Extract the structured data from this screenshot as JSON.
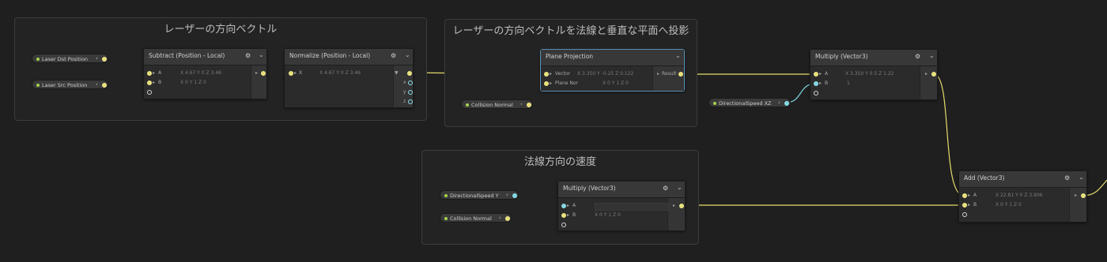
{
  "groups": {
    "laser_dir": "レーザーの方向ベクトル",
    "projection": "レーザーの方向ベクトルを法線と垂直な平面へ投影",
    "normal_speed": "法線方向の速度"
  },
  "props": {
    "laser_dst": "Laser Dst Position",
    "laser_src": "Laser Src Position",
    "collision_normal_1": "Collision Normal",
    "directional_speed_xz": "DirectionalSpeed XZ",
    "directional_speed_y": "DirectionalSpeed Y",
    "collision_normal_2": "Collision Normal"
  },
  "nodes": {
    "subtract": {
      "title": "Subtract (Position - Local)",
      "in_a": "A",
      "in_b": "B",
      "a_fields": "X 4.67  Y 0      Z 3.46",
      "b_fields": "X 0      Y 1      Z 0"
    },
    "normalize": {
      "title": "Normalize (Position - Local)",
      "in_x": "X",
      "x_fields": "X 4.67  Y 0      Z 3.46",
      "out_x": "x",
      "out_y": "y",
      "out_z": "z"
    },
    "plane_proj": {
      "title": "Plane Projection",
      "in_vector": "Vector",
      "in_plane": "Plane Nor",
      "vector_fields": "X 3.350   Y -0.25   Z 0.122",
      "plane_fields": "X 0   Y 1   Z 0",
      "out_result": "Result"
    },
    "multiply_top": {
      "title": "Multiply (Vector3)",
      "in_a": "A",
      "in_b": "B",
      "a_fields": "X 3.350   Y 0.5    Z 1.22",
      "b_fields": "1"
    },
    "multiply_bottom": {
      "title": "Multiply (Vector3)",
      "in_a": "A",
      "in_b": "B",
      "b_fields": "X 0      Y 1      Z 0"
    },
    "add": {
      "title": "Add (Vector3)",
      "in_a": "A",
      "in_b": "B",
      "a_fields": "X 22.81   Y 0      Z 3.906",
      "b_fields": "X 0      Y 1      Z 0"
    }
  },
  "icons": {
    "gear": "gear-icon",
    "chevron": "chevron-down-icon",
    "collapse": "collapse-arrow-icon"
  },
  "colors": {
    "vector3_wire": "#e4dc6c",
    "float_wire": "#7cd4de",
    "property_dot": "#a4d44c",
    "selected_border": "#5a8fb4"
  }
}
